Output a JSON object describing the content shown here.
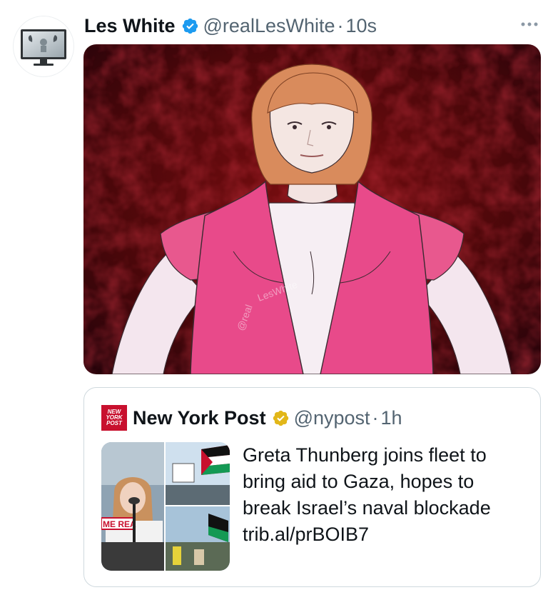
{
  "tweet": {
    "author_name": "Les White",
    "handle": "@realLesWhite",
    "separator": "·",
    "time": "10s",
    "more_icon": "more-horizontal-icon",
    "media_watermark": "@realLesWhite",
    "colors": {
      "verified": "#1d9bf0",
      "muted": "#536471",
      "vest": "#e84a8a"
    }
  },
  "quote": {
    "author_name": "New York Post",
    "logo_text": [
      "NEW",
      "YORK",
      "POST"
    ],
    "handle": "@nypost",
    "separator": "·",
    "time": "1h",
    "thumb_sign_text": "ME REA",
    "text_lines": [
      "Greta Thunberg joins fleet to",
      "bring aid to Gaza, hopes to",
      "break Israel’s naval blockade",
      "trib.al/prBOIB7"
    ],
    "colors": {
      "gold_check": "#e2b719",
      "logo_bg": "#c8102e"
    }
  }
}
